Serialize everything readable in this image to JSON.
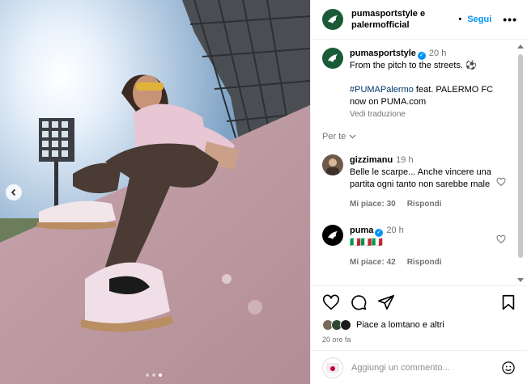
{
  "header": {
    "account_line1": "pumasportstyle e",
    "account_line2": "palermofficial",
    "separator": "•",
    "follow_label": "Segui",
    "more_label": "•••"
  },
  "caption": {
    "username": "pumasportstyle",
    "time": "20 h",
    "text_line1": "From the pitch to the streets. ⚽",
    "hashtag": "#PUMAPalermo",
    "text_line2_rest": " feat. PALERMO FC",
    "text_line3": "now on PUMA.com",
    "translate_label": "Vedi traduzione"
  },
  "per_te_label": "Per te",
  "comments": [
    {
      "username": "gizzimanu",
      "time": "19 h",
      "text": "Belle le scarpe... Anche vincere una partita ogni tanto non sarebbe male",
      "likes": "Mi piace: 30",
      "reply": "Rispondi"
    },
    {
      "username": "puma",
      "time": "20 h",
      "text": "🇮🇹🇮🇹🇮🇹",
      "likes": "Mi piace: 42",
      "reply": "Rispondi"
    }
  ],
  "likes_line": "Piace a lomtano e altri",
  "post_age": "20 ore fa",
  "add_comment_placeholder": "Aggiungi un commento...",
  "carousel": {
    "total": 3,
    "active": 2
  },
  "colors": {
    "accent": "#0095f6",
    "puma_green": "#1b5a36"
  }
}
